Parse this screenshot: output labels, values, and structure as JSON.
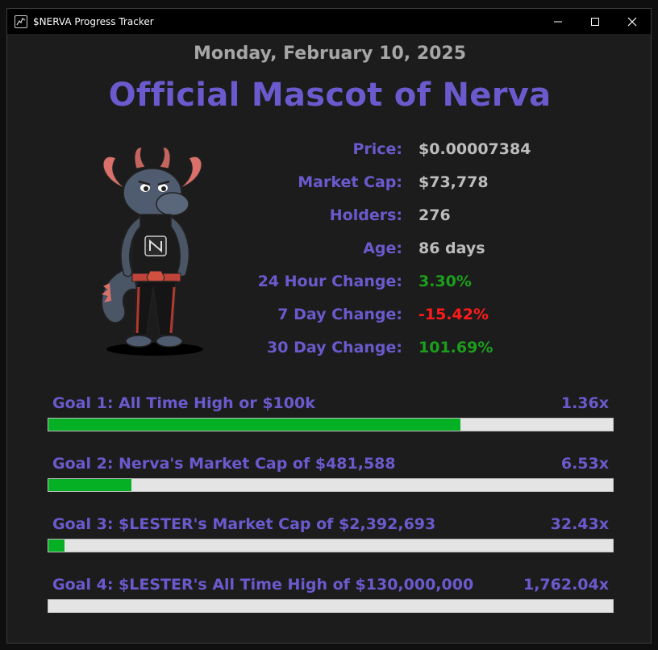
{
  "window": {
    "title": "$NERVA Progress Tracker"
  },
  "header": {
    "date": "Monday, February 10, 2025",
    "heading": "Official Mascot of Nerva"
  },
  "stats": [
    {
      "label": "Price:",
      "value": "$0.00007384",
      "color": "#bdbdbd"
    },
    {
      "label": "Market Cap:",
      "value": "$73,778",
      "color": "#bdbdbd"
    },
    {
      "label": "Holders:",
      "value": "276",
      "color": "#bdbdbd"
    },
    {
      "label": "Age:",
      "value": "86 days",
      "color": "#bdbdbd"
    },
    {
      "label": "24 Hour Change:",
      "value": "3.30%",
      "color": "#1c9e1c"
    },
    {
      "label": "7 Day Change:",
      "value": "-15.42%",
      "color": "#ff1a1a"
    },
    {
      "label": "30 Day Change:",
      "value": "101.69%",
      "color": "#1c9e1c"
    }
  ],
  "goals": [
    {
      "label": "Goal 1: All Time High or $100k",
      "multiplier": "1.36x",
      "progress": 0.73
    },
    {
      "label": "Goal 2: Nerva's Market Cap of $481,588",
      "multiplier": "6.53x",
      "progress": 0.147
    },
    {
      "label": "Goal 3: $LESTER's Market Cap of $2,392,693",
      "multiplier": "32.43x",
      "progress": 0.029
    },
    {
      "label": "Goal 4: $LESTER's All Time High of $130,000,000",
      "multiplier": "1,762.04x",
      "progress": 0.0
    }
  ],
  "colors": {
    "accent": "#6a5acd",
    "progress_fill": "#06b025",
    "positive": "#1c9e1c",
    "negative": "#ff1a1a"
  }
}
